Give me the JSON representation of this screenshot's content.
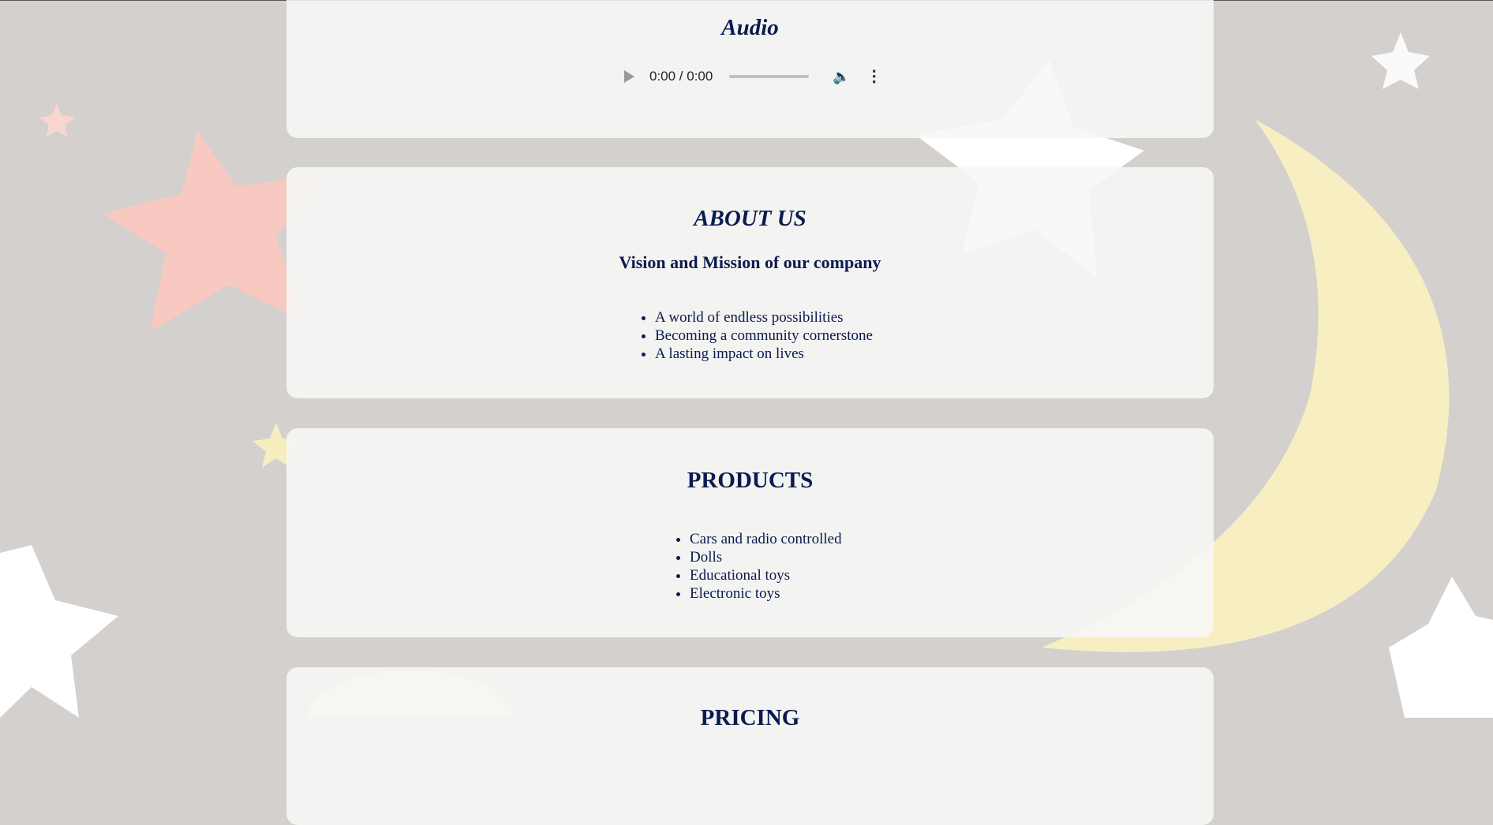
{
  "audio": {
    "title": "Audio",
    "time": "0:00 / 0:00"
  },
  "about": {
    "title": "ABOUT US",
    "subtitle": "Vision and Mission of our company",
    "items": [
      "A world of endless possibilities",
      "Becoming a community cornerstone",
      "A lasting impact on lives"
    ]
  },
  "products": {
    "title": "PRODUCTS",
    "items": [
      "Cars and radio controlled",
      "Dolls",
      "Educational toys",
      "Electronic toys"
    ]
  },
  "pricing": {
    "title": "PRICING"
  },
  "colors": {
    "text": "#0b1a4f",
    "background": "#d3d0ce",
    "card": "#f7f7f6"
  }
}
